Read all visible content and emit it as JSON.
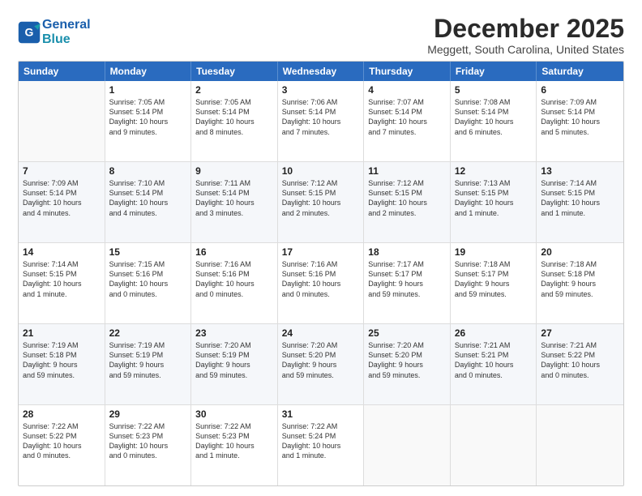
{
  "header": {
    "logo_line1": "General",
    "logo_line2": "Blue",
    "month": "December 2025",
    "location": "Meggett, South Carolina, United States"
  },
  "calendar": {
    "days": [
      "Sunday",
      "Monday",
      "Tuesday",
      "Wednesday",
      "Thursday",
      "Friday",
      "Saturday"
    ],
    "rows": [
      [
        {
          "day": "",
          "empty": true,
          "content": ""
        },
        {
          "day": "1",
          "content": "Sunrise: 7:05 AM\nSunset: 5:14 PM\nDaylight: 10 hours\nand 9 minutes."
        },
        {
          "day": "2",
          "content": "Sunrise: 7:05 AM\nSunset: 5:14 PM\nDaylight: 10 hours\nand 8 minutes."
        },
        {
          "day": "3",
          "content": "Sunrise: 7:06 AM\nSunset: 5:14 PM\nDaylight: 10 hours\nand 7 minutes."
        },
        {
          "day": "4",
          "content": "Sunrise: 7:07 AM\nSunset: 5:14 PM\nDaylight: 10 hours\nand 7 minutes."
        },
        {
          "day": "5",
          "content": "Sunrise: 7:08 AM\nSunset: 5:14 PM\nDaylight: 10 hours\nand 6 minutes."
        },
        {
          "day": "6",
          "content": "Sunrise: 7:09 AM\nSunset: 5:14 PM\nDaylight: 10 hours\nand 5 minutes."
        }
      ],
      [
        {
          "day": "7",
          "content": "Sunrise: 7:09 AM\nSunset: 5:14 PM\nDaylight: 10 hours\nand 4 minutes."
        },
        {
          "day": "8",
          "content": "Sunrise: 7:10 AM\nSunset: 5:14 PM\nDaylight: 10 hours\nand 4 minutes."
        },
        {
          "day": "9",
          "content": "Sunrise: 7:11 AM\nSunset: 5:14 PM\nDaylight: 10 hours\nand 3 minutes."
        },
        {
          "day": "10",
          "content": "Sunrise: 7:12 AM\nSunset: 5:15 PM\nDaylight: 10 hours\nand 2 minutes."
        },
        {
          "day": "11",
          "content": "Sunrise: 7:12 AM\nSunset: 5:15 PM\nDaylight: 10 hours\nand 2 minutes."
        },
        {
          "day": "12",
          "content": "Sunrise: 7:13 AM\nSunset: 5:15 PM\nDaylight: 10 hours\nand 1 minute."
        },
        {
          "day": "13",
          "content": "Sunrise: 7:14 AM\nSunset: 5:15 PM\nDaylight: 10 hours\nand 1 minute."
        }
      ],
      [
        {
          "day": "14",
          "content": "Sunrise: 7:14 AM\nSunset: 5:15 PM\nDaylight: 10 hours\nand 1 minute."
        },
        {
          "day": "15",
          "content": "Sunrise: 7:15 AM\nSunset: 5:16 PM\nDaylight: 10 hours\nand 0 minutes."
        },
        {
          "day": "16",
          "content": "Sunrise: 7:16 AM\nSunset: 5:16 PM\nDaylight: 10 hours\nand 0 minutes."
        },
        {
          "day": "17",
          "content": "Sunrise: 7:16 AM\nSunset: 5:16 PM\nDaylight: 10 hours\nand 0 minutes."
        },
        {
          "day": "18",
          "content": "Sunrise: 7:17 AM\nSunset: 5:17 PM\nDaylight: 9 hours\nand 59 minutes."
        },
        {
          "day": "19",
          "content": "Sunrise: 7:18 AM\nSunset: 5:17 PM\nDaylight: 9 hours\nand 59 minutes."
        },
        {
          "day": "20",
          "content": "Sunrise: 7:18 AM\nSunset: 5:18 PM\nDaylight: 9 hours\nand 59 minutes."
        }
      ],
      [
        {
          "day": "21",
          "content": "Sunrise: 7:19 AM\nSunset: 5:18 PM\nDaylight: 9 hours\nand 59 minutes."
        },
        {
          "day": "22",
          "content": "Sunrise: 7:19 AM\nSunset: 5:19 PM\nDaylight: 9 hours\nand 59 minutes."
        },
        {
          "day": "23",
          "content": "Sunrise: 7:20 AM\nSunset: 5:19 PM\nDaylight: 9 hours\nand 59 minutes."
        },
        {
          "day": "24",
          "content": "Sunrise: 7:20 AM\nSunset: 5:20 PM\nDaylight: 9 hours\nand 59 minutes."
        },
        {
          "day": "25",
          "content": "Sunrise: 7:20 AM\nSunset: 5:20 PM\nDaylight: 9 hours\nand 59 minutes."
        },
        {
          "day": "26",
          "content": "Sunrise: 7:21 AM\nSunset: 5:21 PM\nDaylight: 10 hours\nand 0 minutes."
        },
        {
          "day": "27",
          "content": "Sunrise: 7:21 AM\nSunset: 5:22 PM\nDaylight: 10 hours\nand 0 minutes."
        }
      ],
      [
        {
          "day": "28",
          "content": "Sunrise: 7:22 AM\nSunset: 5:22 PM\nDaylight: 10 hours\nand 0 minutes."
        },
        {
          "day": "29",
          "content": "Sunrise: 7:22 AM\nSunset: 5:23 PM\nDaylight: 10 hours\nand 0 minutes."
        },
        {
          "day": "30",
          "content": "Sunrise: 7:22 AM\nSunset: 5:23 PM\nDaylight: 10 hours\nand 1 minute."
        },
        {
          "day": "31",
          "content": "Sunrise: 7:22 AM\nSunset: 5:24 PM\nDaylight: 10 hours\nand 1 minute."
        },
        {
          "day": "",
          "empty": true,
          "content": ""
        },
        {
          "day": "",
          "empty": true,
          "content": ""
        },
        {
          "day": "",
          "empty": true,
          "content": ""
        }
      ]
    ]
  }
}
